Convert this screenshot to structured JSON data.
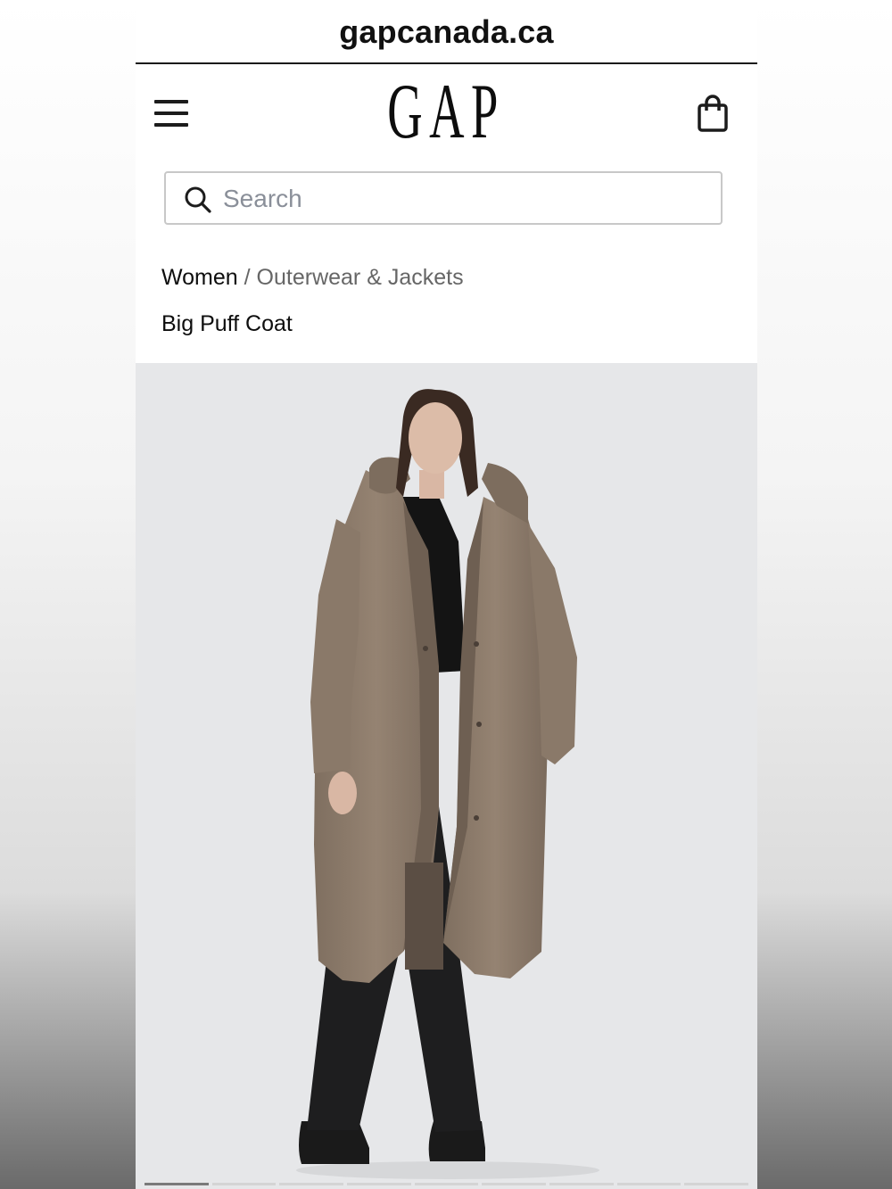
{
  "browser": {
    "url": "gapcanada.ca"
  },
  "header": {
    "logo_text": "GAP",
    "menu_icon": "hamburger-menu-icon",
    "bag_icon": "shopping-bag-icon"
  },
  "search": {
    "placeholder": "Search",
    "value": "",
    "icon": "search-icon"
  },
  "breadcrumb": {
    "current": "Women",
    "separator": "/",
    "parent": "Outerwear & Jackets"
  },
  "product": {
    "title": "Big Puff Coat",
    "image_alt": "Model wearing long taupe hooded puffer coat with black top, black jeans and black boots",
    "coat_color": "#8c7b6b",
    "image_background": "#e6e7e9"
  },
  "carousel": {
    "total": 9,
    "active_index": 0
  },
  "colors": {
    "text_primary": "#0e0e0e",
    "text_secondary": "#666666",
    "border": "#c8c8c8"
  }
}
